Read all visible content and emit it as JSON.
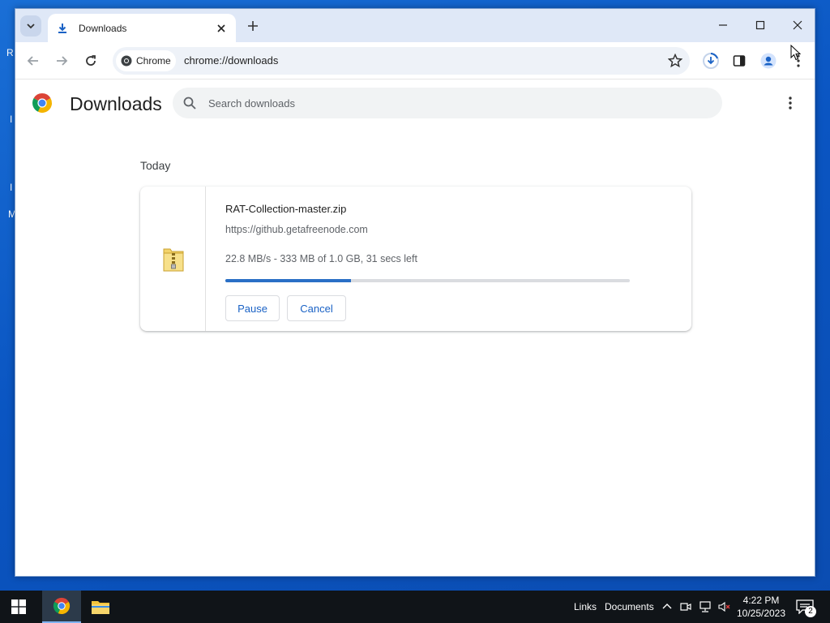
{
  "desktop": {
    "edge_glyphs": [
      "R",
      "I",
      "I",
      "M"
    ]
  },
  "tabs": [
    {
      "title": "Downloads",
      "icon": "download-icon"
    }
  ],
  "toolbar": {
    "chip_label": "Chrome",
    "url": "chrome://downloads"
  },
  "page": {
    "title": "Downloads",
    "search_placeholder": "Search downloads",
    "section_label": "Today"
  },
  "download": {
    "file_name": "RAT-Collection-master.zip",
    "source_url": "https://github.getafreenode.com",
    "status": "22.8 MB/s - 333 MB of 1.0 GB, 31 secs left",
    "progress_fraction": 0.31,
    "pause_label": "Pause",
    "cancel_label": "Cancel",
    "file_icon": "zip-folder-icon"
  },
  "taskbar": {
    "links_label": "Links",
    "documents_label": "Documents",
    "time": "4:22 PM",
    "date": "10/25/2023",
    "notification_count": "2"
  },
  "colors": {
    "accent_blue": "#1a62c5",
    "progress_blue": "#2a6fc6",
    "tabstrip": "#dfe8f7",
    "taskbar": "#101418"
  }
}
